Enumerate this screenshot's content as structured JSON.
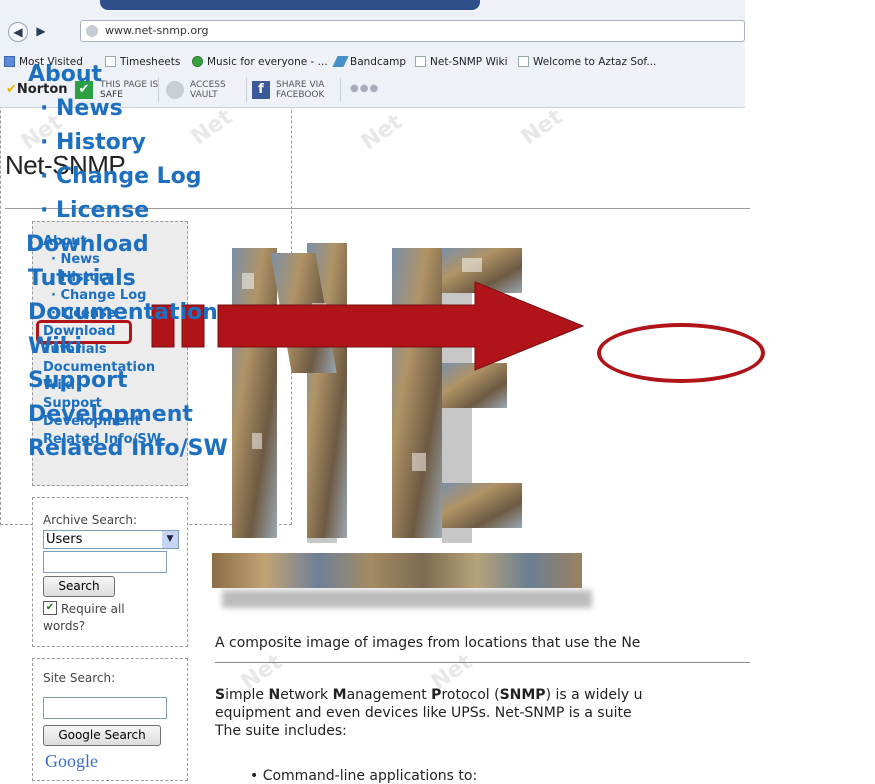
{
  "browser": {
    "url": "www.net-snmp.org",
    "bookmarks": [
      "Most Visited",
      "Timesheets",
      "Music for everyone - ...",
      "Bandcamp",
      "Net-SNMP Wiki",
      "Welcome to Aztaz Sof..."
    ],
    "norton": {
      "brand": "Norton",
      "page_status_top": "THIS PAGE IS",
      "page_status_bottom": "SAFE",
      "vault_top": "ACCESS",
      "vault_bottom": "VAULT",
      "share_top": "SHARE VIA",
      "share_bottom": "FACEBOOK"
    }
  },
  "site": {
    "title": "Net-SNMP",
    "nav": {
      "about": "About",
      "news": "· News",
      "history": "· History",
      "changelog": "· Change Log",
      "license": "· License",
      "download": "Download",
      "tutorials": "Tutorials",
      "documentation": "Documentation",
      "wiki": "Wiki",
      "support": "Support",
      "development": "Development",
      "related": "Related Info/SW"
    },
    "archive_search": {
      "label": "Archive Search:",
      "selected": "Users",
      "button": "Search",
      "require_line1": "Require all",
      "require_line2": "words?"
    },
    "site_search": {
      "label": "Site Search:",
      "button": "Google Search",
      "logo": "Google"
    },
    "caption": "A composite image of images from locations that use the Ne",
    "para_line1_a": "S",
    "para_line1_b": "imple ",
    "para_line1_c": "N",
    "para_line1_d": "etwork ",
    "para_line1_e": "M",
    "para_line1_f": "anagement ",
    "para_line1_g": "P",
    "para_line1_h": "rotocol (",
    "para_line1_i": "SNMP",
    "para_line1_j": ") is a widely u",
    "para_line2": "equipment and even devices like UPSs. Net-SNMP is a suite",
    "para_line3": "The suite includes:",
    "bullet": "• Command-line applications to:"
  },
  "colors": {
    "nav_link": "#1d6fbf",
    "highlight": "#b01318"
  }
}
